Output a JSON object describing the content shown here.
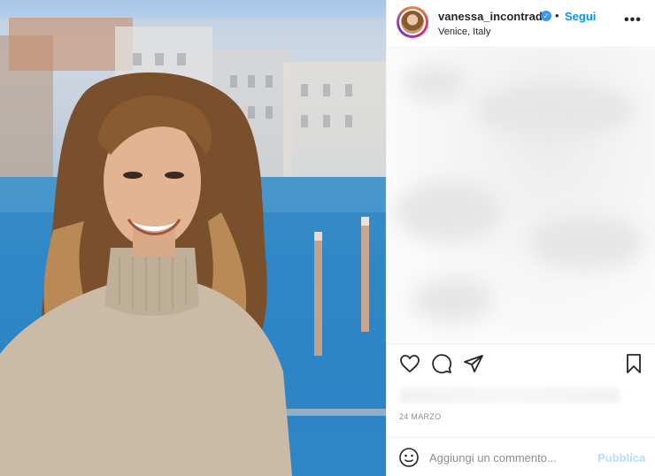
{
  "post": {
    "username": "vanessa_incontrada",
    "verified_icon": "verified-badge-icon",
    "separator": "•",
    "follow_label": "Segui",
    "location": "Venice, Italy",
    "more_icon_text": "•••",
    "date": "24 MARZO"
  },
  "comment_box": {
    "placeholder": "Aggiungi un commento...",
    "publish_label": "Pubblica"
  },
  "icons": {
    "like": "heart-icon",
    "comment": "comment-bubble-icon",
    "share": "paper-plane-icon",
    "save": "bookmark-icon",
    "emoji": "emoji-smile-icon"
  },
  "colors": {
    "link_blue": "#0095f6",
    "publish_disabled": "#b2dffc",
    "verified_blue": "#3897f0"
  }
}
